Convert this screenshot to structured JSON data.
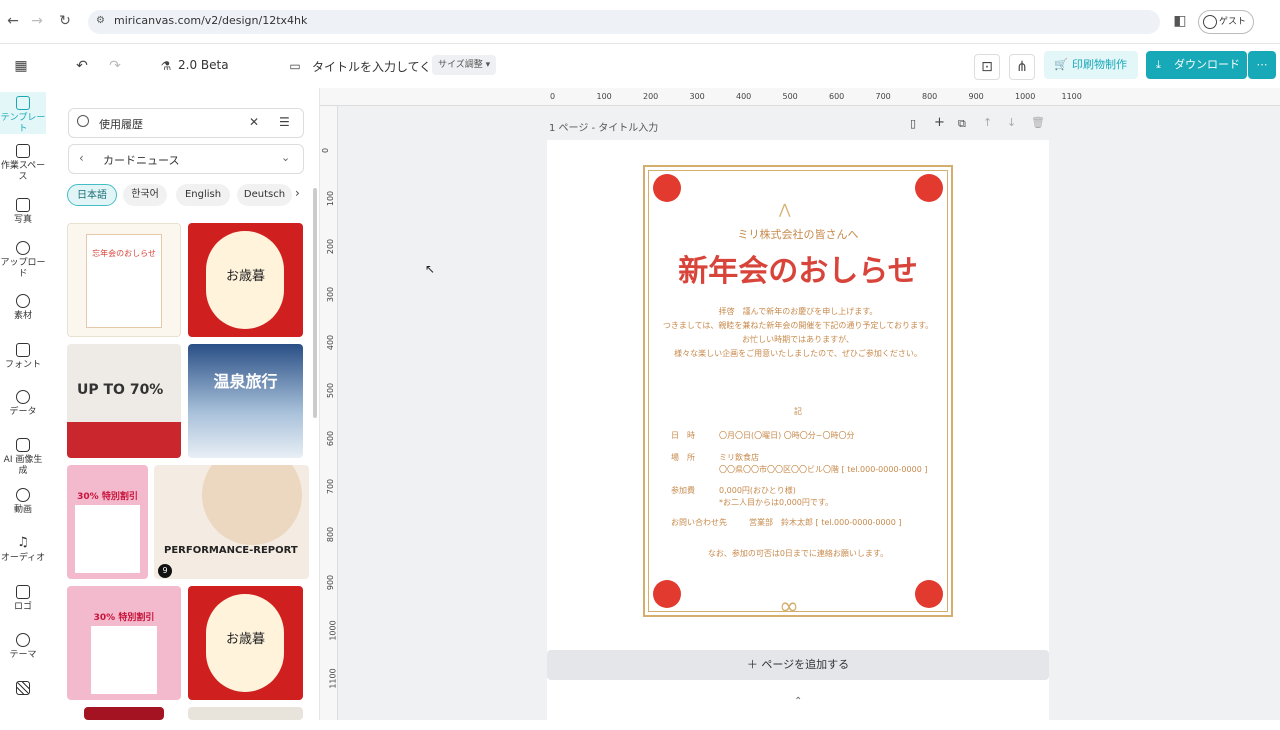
{
  "browser": {
    "url": "miricanvas.com/v2/design/12tx4hk",
    "guest": "ゲスト"
  },
  "header": {
    "version": "2.0 Beta",
    "title": "タイトルを入力してくた",
    "size_edit": "サイズ調整",
    "print_btn": "印刷物制作",
    "download_btn": "ダウンロード"
  },
  "rail": [
    {
      "label": "テンプレート",
      "name": "template"
    },
    {
      "label": "作業スペース",
      "name": "workspace"
    },
    {
      "label": "写真",
      "name": "photo"
    },
    {
      "label": "アップロード",
      "name": "upload"
    },
    {
      "label": "素材",
      "name": "material"
    },
    {
      "label": "フォント",
      "name": "font"
    },
    {
      "label": "データ",
      "name": "data"
    },
    {
      "label": "AI 画像生成",
      "name": "ai-image"
    },
    {
      "label": "動画",
      "name": "video"
    },
    {
      "label": "オーディオ",
      "name": "audio"
    },
    {
      "label": "ロゴ",
      "name": "logo"
    },
    {
      "label": "テーマ",
      "name": "theme"
    }
  ],
  "panel": {
    "search_value": "使用履歴",
    "category": "カードニュース",
    "chips": [
      "日本語",
      "한국어",
      "English",
      "Deutsch"
    ],
    "thumb_texts": {
      "t1": "忘年会のおしらせ",
      "t2": "お歳暮",
      "t3": "UP TO 70%",
      "t4": "温泉旅行",
      "t5": "30% 特別割引",
      "t6": "PERFORMANCE-REPORT",
      "t6_badge": "9",
      "t7": "30% 特別割引",
      "t8": "お歳暮"
    }
  },
  "canvas": {
    "ruler_h": [
      "0",
      "100",
      "200",
      "300",
      "400",
      "500",
      "600",
      "700",
      "800",
      "900",
      "1000",
      "1100"
    ],
    "ruler_v": [
      "0",
      "100",
      "200",
      "300",
      "400",
      "500",
      "600",
      "700",
      "800",
      "900",
      "1000",
      "1100"
    ],
    "page_label": "1 ページ - タイトル入力",
    "add_page": "ページを追加する"
  },
  "flyer": {
    "subtitle": "ミリ株式会社の皆さんへ",
    "title": "新年会のおしらせ",
    "body1": "拝啓　謹んで新年のお慶びを申し上げます。",
    "body2": "つきましては、親睦を兼ねた新年会の開催を下記の通り予定しております。",
    "body3": "お忙しい時期ではありますが、",
    "body4": "様々な楽しい企画をご用意いたしましたので、ぜひご参加ください。",
    "ki": "記",
    "date_label": "日　時",
    "date_value": "〇月〇日(〇曜日) 〇時〇分~〇時〇分",
    "place_label": "場　所",
    "place_value1": "ミリ飲食店",
    "place_value2": "〇〇県〇〇市〇〇区〇〇ビル〇階 [ tel.000-0000-0000 ]",
    "fee_label": "参加費",
    "fee_value1": "0,000円(おひとり様)",
    "fee_value2": "*お二人目からは0,000円です。",
    "contact_label": "お問い合わせ先",
    "contact_value": "営業部　鈴木太郎 [ tel.000-0000-0000 ]",
    "footer": "なお、参加の可否は0日までに連絡お願いします。"
  },
  "colors": {
    "accent_teal": "#18a9b8",
    "flyer_red": "#e23a2e",
    "flyer_gold": "#d4ae6c"
  }
}
